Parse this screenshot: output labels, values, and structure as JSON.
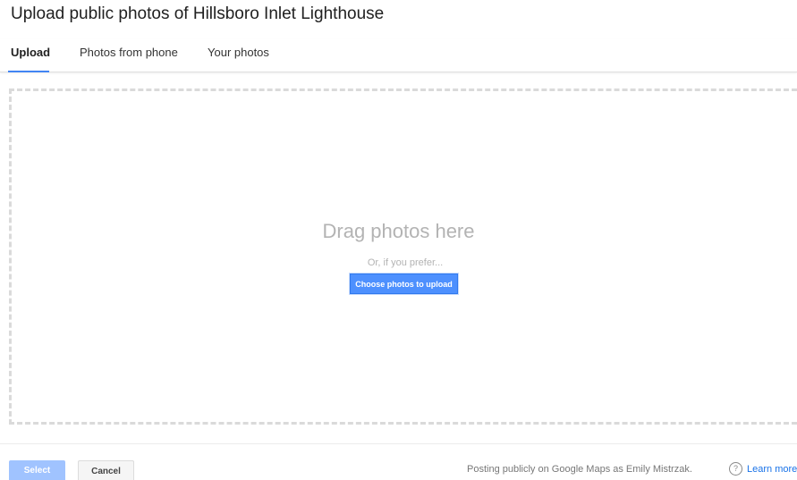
{
  "dialog": {
    "title": "Upload public photos of Hillsboro Inlet Lighthouse"
  },
  "tabs": [
    {
      "label": "Upload",
      "active": true
    },
    {
      "label": "Photos from phone",
      "active": false
    },
    {
      "label": "Your photos",
      "active": false
    }
  ],
  "dropzone": {
    "headline": "Drag photos here",
    "alt_text": "Or, if you prefer...",
    "choose_button_label": "Choose photos to upload"
  },
  "footer": {
    "select_label": "Select",
    "cancel_label": "Cancel",
    "posting_notice": "Posting publicly on Google Maps as Emily Mistrzak.",
    "help_icon": "question-circle-icon",
    "learn_more_label": "Learn more"
  },
  "colors": {
    "accent": "#4285f4",
    "primary_button": "#4d90fe",
    "disabled_button": "#a0c3ff",
    "link": "#1a73e8"
  }
}
